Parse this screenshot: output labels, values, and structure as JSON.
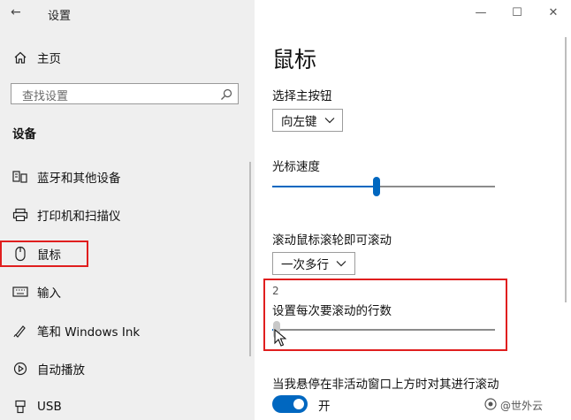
{
  "window": {
    "title": "设置",
    "back_glyph": "←",
    "minimize_glyph": "—",
    "maximize_glyph": "☐",
    "close_glyph": "✕"
  },
  "sidebar": {
    "home_label": "主页",
    "search_placeholder": "查找设置",
    "section_heading": "设备",
    "items": [
      {
        "label": "蓝牙和其他设备",
        "icon": "bluetooth-device-icon"
      },
      {
        "label": "打印机和扫描仪",
        "icon": "printer-icon"
      },
      {
        "label": "鼠标",
        "icon": "mouse-icon"
      },
      {
        "label": "输入",
        "icon": "keyboard-icon"
      },
      {
        "label": "笔和 Windows Ink",
        "icon": "pen-icon"
      },
      {
        "label": "自动播放",
        "icon": "autoplay-icon"
      },
      {
        "label": "USB",
        "icon": "usb-icon"
      }
    ]
  },
  "main": {
    "title": "鼠标",
    "primary_button": {
      "label": "选择主按钮",
      "value": "向左键"
    },
    "cursor_speed": {
      "label": "光标速度",
      "value_fraction": 0.47
    },
    "scroll_mode": {
      "label": "滚动鼠标滚轮即可滚动",
      "value": "一次多行"
    },
    "lines_to_scroll": {
      "label": "设置每次要滚动的行数",
      "value": "2",
      "value_fraction": 0.02
    },
    "inactive_scroll": {
      "label": "当我悬停在非活动窗口上方时对其进行滚动",
      "toggle_label": "开",
      "on": true
    }
  },
  "watermark": {
    "text": "@世外云"
  },
  "colors": {
    "accent": "#0067c0",
    "highlight_border": "#e01e1e",
    "sidebar_bg": "#efefef"
  }
}
